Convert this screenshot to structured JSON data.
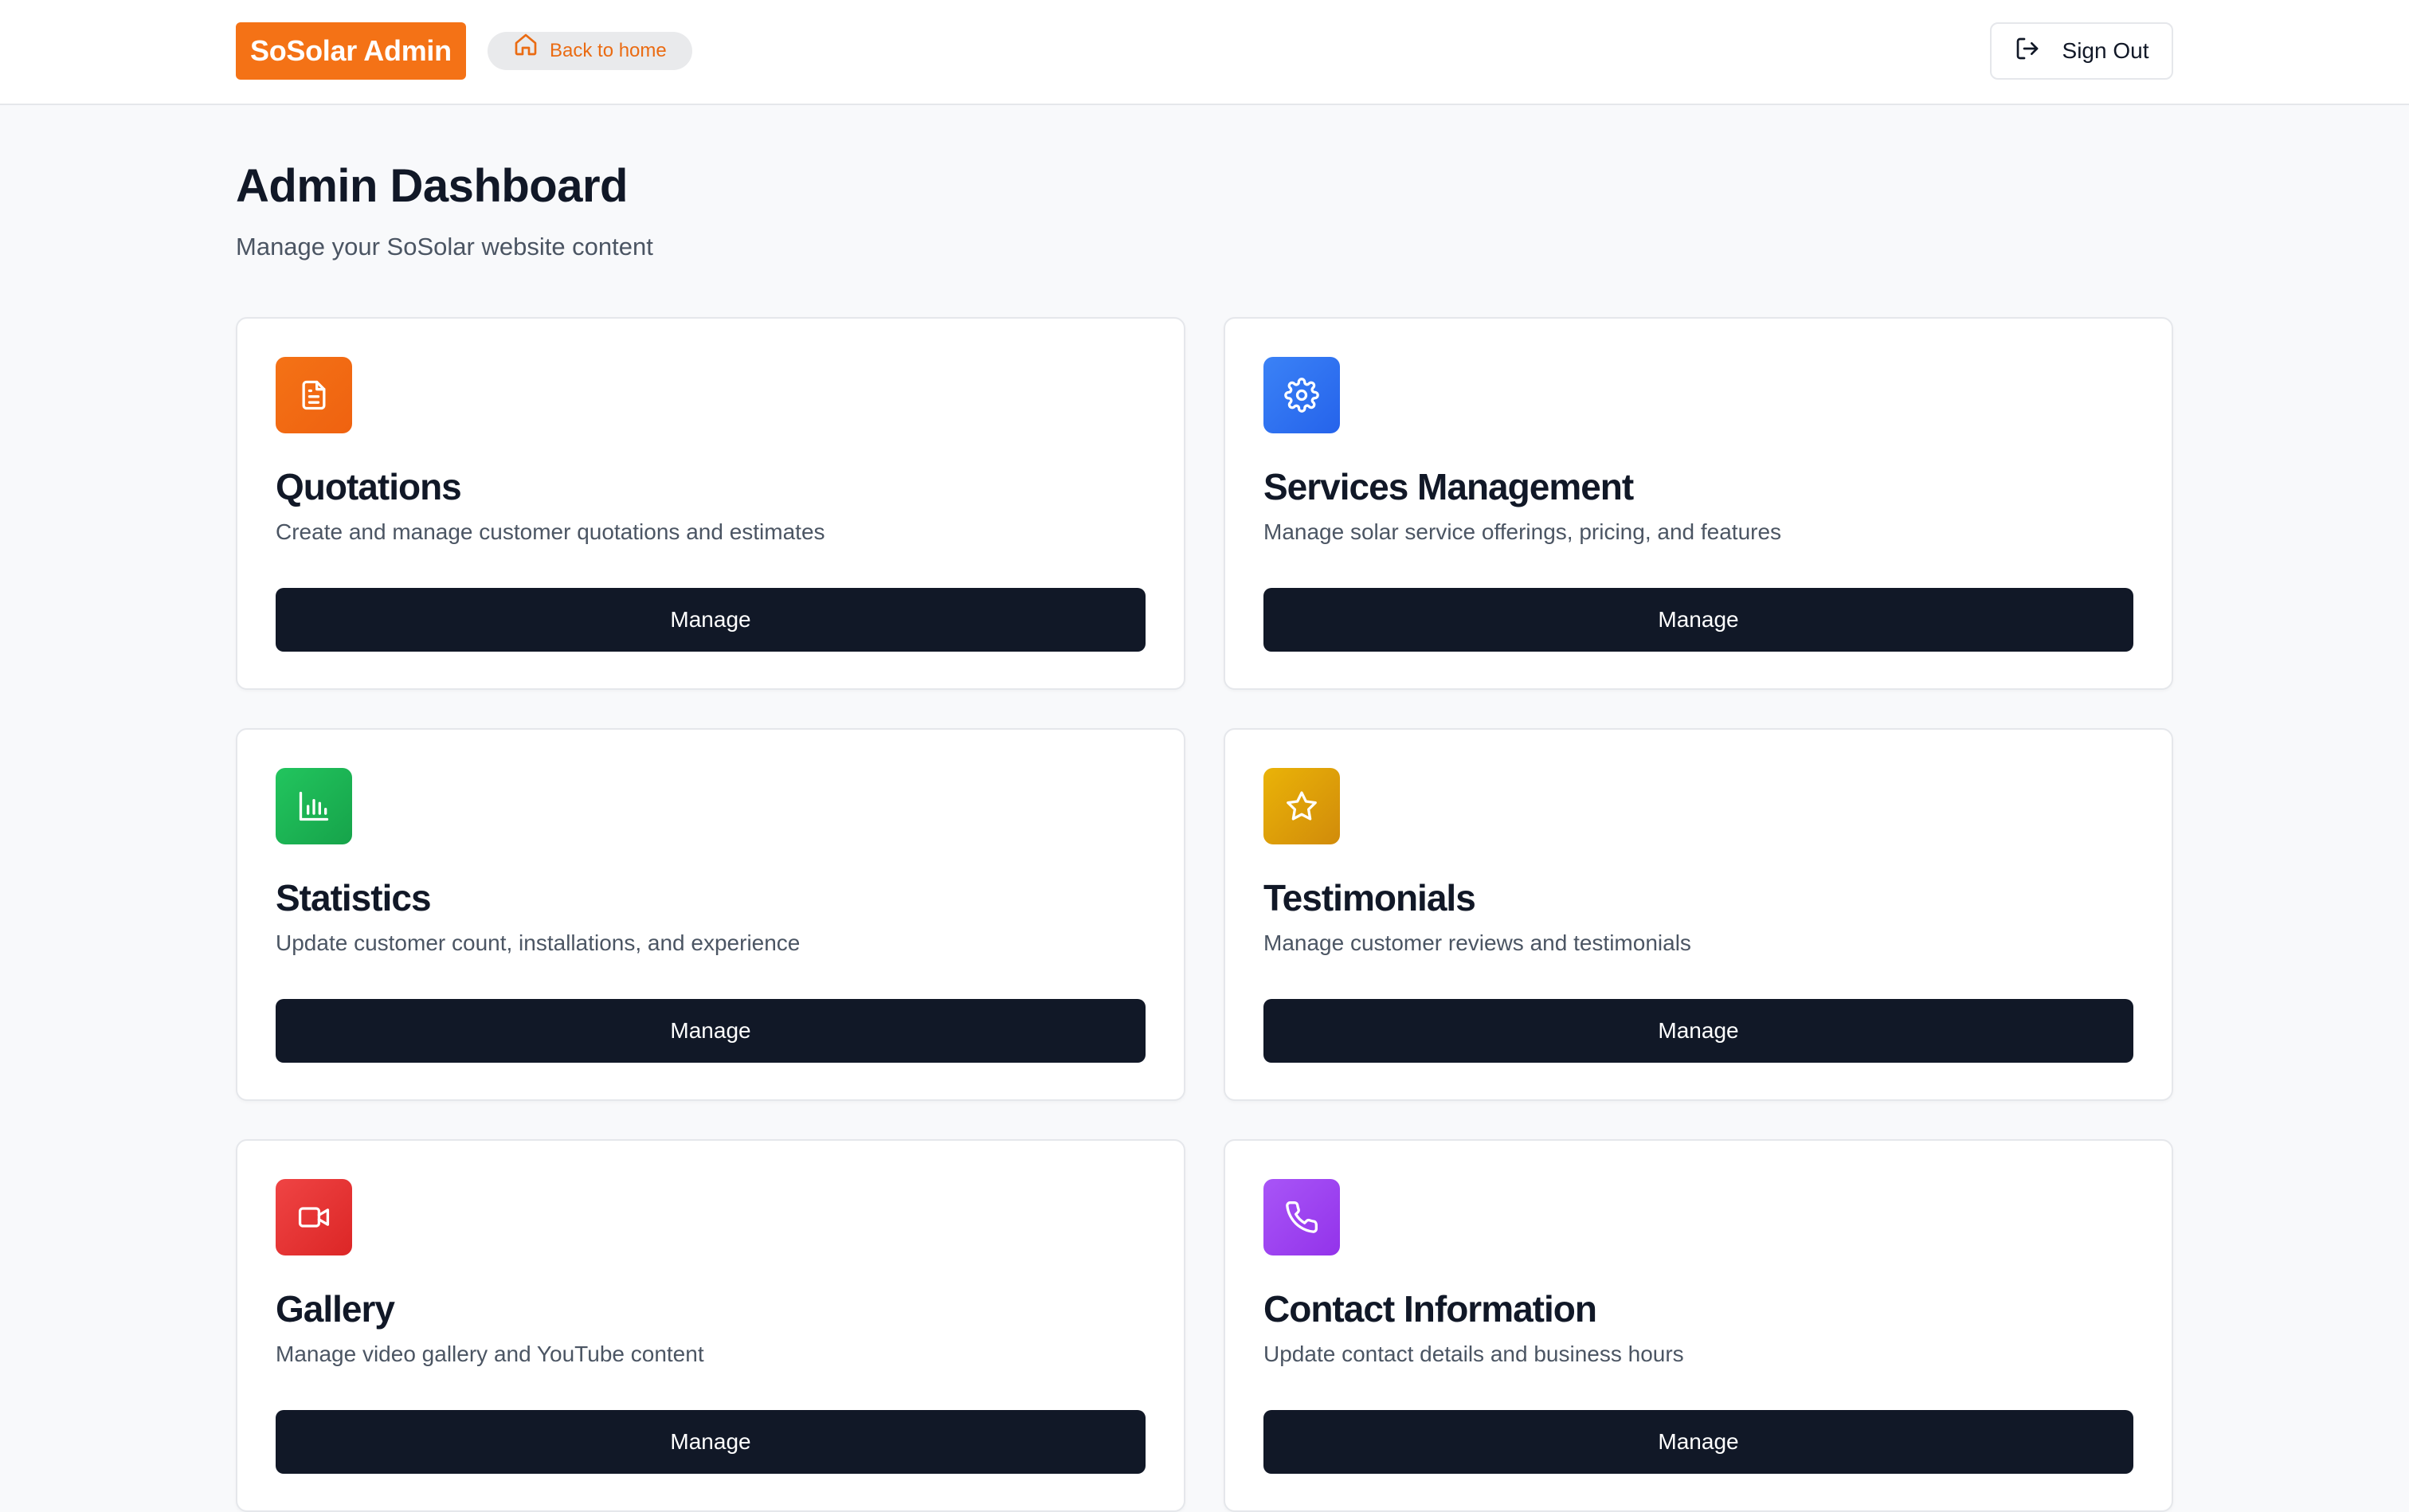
{
  "header": {
    "brand": "SoSolar Admin",
    "back_home": "Back to home",
    "sign_out": "Sign Out"
  },
  "main": {
    "title": "Admin Dashboard",
    "subtitle": "Manage your SoSolar website content"
  },
  "cards": [
    {
      "title": "Quotations",
      "description": "Create and manage customer quotations and estimates",
      "button": "Manage",
      "icon": "document-icon",
      "color": "#f47216"
    },
    {
      "title": "Services Management",
      "description": "Manage solar service offerings, pricing, and features",
      "button": "Manage",
      "icon": "gear-icon",
      "color": "#3b7bf0"
    },
    {
      "title": "Statistics",
      "description": "Update customer count, installations, and experience",
      "button": "Manage",
      "icon": "bar-chart-icon",
      "color": "#22b35a"
    },
    {
      "title": "Testimonials",
      "description": "Manage customer reviews and testimonials",
      "button": "Manage",
      "icon": "star-icon",
      "color": "#e3a40b"
    },
    {
      "title": "Gallery",
      "description": "Manage video gallery and YouTube content",
      "button": "Manage",
      "icon": "video-camera-icon",
      "color": "#e8383d"
    },
    {
      "title": "Contact Information",
      "description": "Update contact details and business hours",
      "button": "Manage",
      "icon": "phone-icon",
      "color": "#a14ef0"
    }
  ]
}
